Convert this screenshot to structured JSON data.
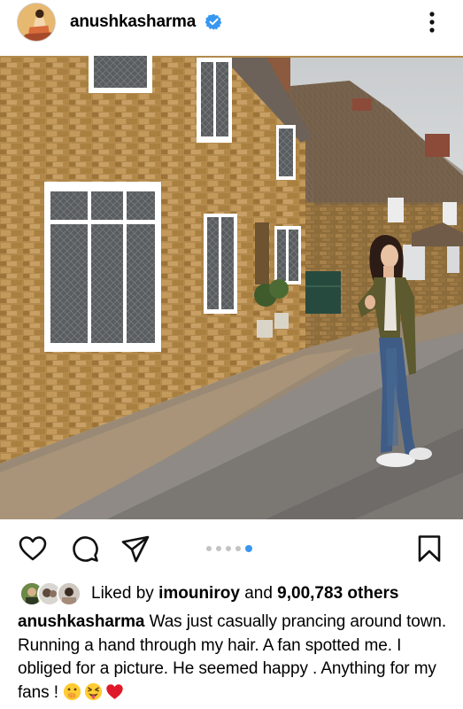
{
  "post": {
    "username": "anushkasharma",
    "verified": true,
    "more_icon": "more-vertical-icon",
    "photo_description_icon": "photo",
    "carousel": {
      "count": 5,
      "active_index": 4
    },
    "actions": {
      "like_icon": "heart-icon",
      "comment_icon": "comment-icon",
      "share_icon": "send-icon",
      "save_icon": "bookmark-icon"
    },
    "likes": {
      "prefix": "Liked by",
      "first_user": "imouniroy",
      "conjunction": "and",
      "count_text": "9,00,783 others"
    },
    "caption": {
      "author": "anushkasharma",
      "text": "Was just casually prancing around town. Running a hand through my hair.  A fan spotted me.  I obliged for a picture. He seemed happy . Anything for my fans !",
      "emojis": [
        "hand-over-mouth-emoji",
        "squinting-tongue-emoji",
        "red-heart-emoji"
      ]
    }
  },
  "colors": {
    "accent_blue": "#3897f0",
    "dot_inactive": "#c3c3c3",
    "heart_red": "#e0192a"
  }
}
